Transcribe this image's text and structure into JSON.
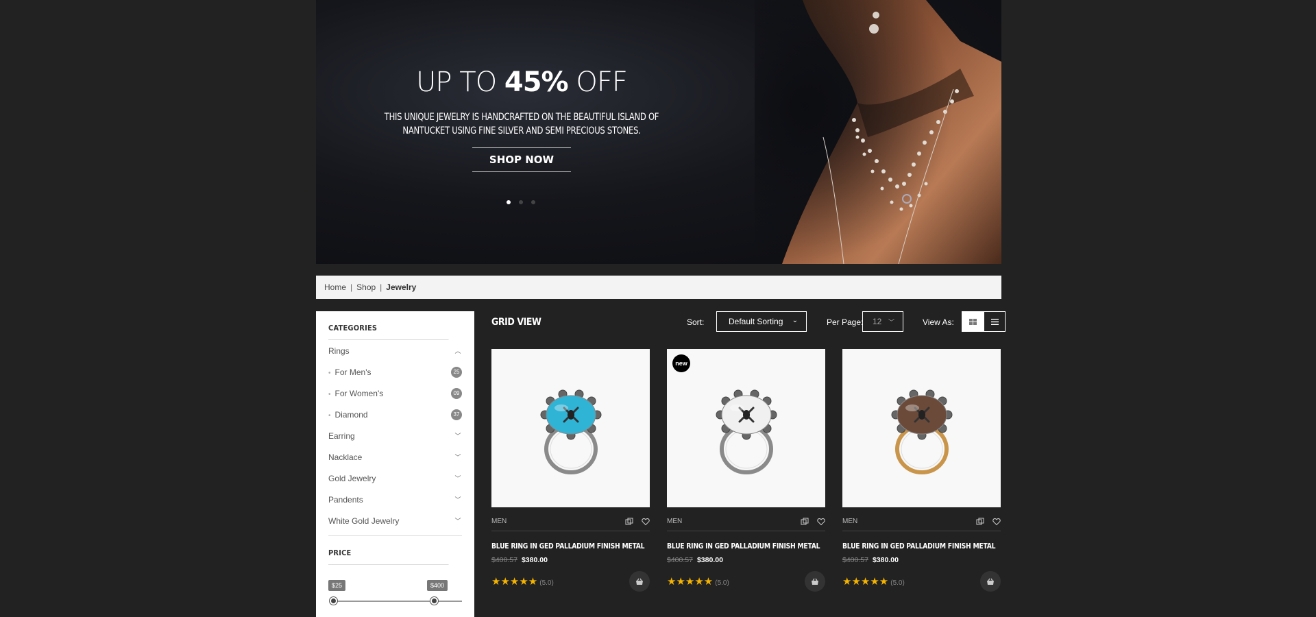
{
  "hero": {
    "title_pre": "UP TO",
    "title_bold": "45%",
    "title_post": "OFF",
    "subtitle_line1": "THIS UNIQUE JEWELRY IS HANDCRAFTED ON THE BEAUTIFUL ISLAND OF",
    "subtitle_line2": "NANTUCKET USING FINE SILVER AND SEMI PRECIOUS STONES.",
    "cta": "SHOP NOW",
    "slides": 3,
    "active_slide": 1
  },
  "breadcrumb": {
    "home": "Home",
    "shop": "Shop",
    "current": "Jewelry",
    "sep": "|"
  },
  "sidebar": {
    "categories_title": "CATEGORIES",
    "rings": "Rings",
    "subs": [
      {
        "label": "For Men's",
        "count": "25"
      },
      {
        "label": "For Women's",
        "count": "09"
      },
      {
        "label": "Diamond",
        "count": "37"
      }
    ],
    "cats": [
      "Earring",
      "Nacklace",
      "Gold Jewelry",
      "Pandents",
      "White Gold Jewelry"
    ],
    "price_title": "PRICE",
    "price_min": "$25",
    "price_max": "$400"
  },
  "toolbar": {
    "title": "GRID VIEW",
    "sort_label": "Sort:",
    "sort_value": "Default Sorting",
    "perpage_label": "Per Page:",
    "perpage_value": "12",
    "viewas_label": "View As:"
  },
  "products": [
    {
      "category": "MEN",
      "name": "BLUE RING IN GED PALLADIUM FINISH METAL",
      "old_price": "$400.57",
      "price": "$380.00",
      "rating": "(5.0)",
      "stone": "#2fb4d6",
      "band": "#8a8a8a",
      "badge": ""
    },
    {
      "category": "MEN",
      "name": "BLUE RING IN GED PALLADIUM FINISH METAL",
      "old_price": "$400.57",
      "price": "$380.00",
      "rating": "(5.0)",
      "stone": "#f0f0f0",
      "band": "#8a8a8a",
      "badge": "new"
    },
    {
      "category": "MEN",
      "name": "BLUE RING IN GED PALLADIUM FINISH METAL",
      "old_price": "$400.57",
      "price": "$380.00",
      "rating": "(5.0)",
      "stone": "#6b4a3a",
      "band": "#c9954b",
      "badge": ""
    }
  ],
  "colors": {
    "page_bg": "#222222",
    "star": "#f5b400",
    "accent_white": "#ffffff"
  }
}
